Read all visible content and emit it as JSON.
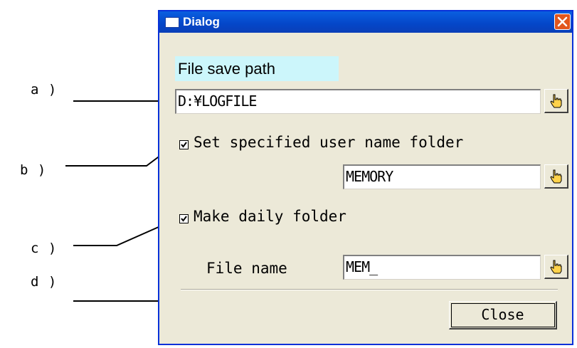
{
  "callouts": {
    "a": "a )",
    "b": "b )",
    "c": "c )",
    "d": "d )"
  },
  "dialog": {
    "title": "Dialog",
    "file_save_path_label": "File save path",
    "path_value": "D:¥LOGFILE",
    "user_folder_checkbox_label": "Set specified user name folder",
    "user_folder_checked": true,
    "user_folder_value": "MEMORY",
    "daily_folder_checkbox_label": "Make daily folder",
    "daily_folder_checked": true,
    "file_name_label": "File name",
    "file_name_value": "MEM_",
    "close_button_label": "Close"
  },
  "colors": {
    "titlebar": "#0a5fe0",
    "dialog_bg": "#ece9d8",
    "label_highlight": "#ccf6fb",
    "close_x": "#e2561d"
  },
  "icons": [
    "window-icon",
    "close-icon",
    "hand-pointer-icon",
    "checkmark-icon"
  ]
}
